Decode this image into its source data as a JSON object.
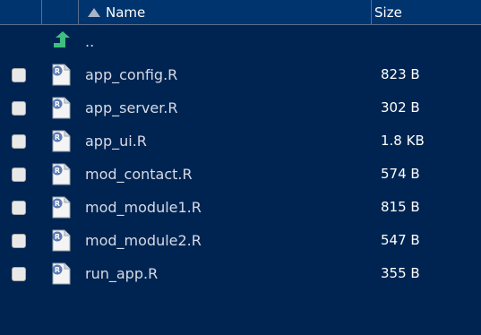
{
  "header": {
    "name_label": "Name",
    "size_label": "Size"
  },
  "parent": {
    "label": ".."
  },
  "files": [
    {
      "name": "app_config.R",
      "size": "823 B"
    },
    {
      "name": "app_server.R",
      "size": "302 B"
    },
    {
      "name": "app_ui.R",
      "size": "1.8 KB"
    },
    {
      "name": "mod_contact.R",
      "size": "574 B"
    },
    {
      "name": "mod_module1.R",
      "size": "815 B"
    },
    {
      "name": "mod_module2.R",
      "size": "547 B"
    },
    {
      "name": "run_app.R",
      "size": "355 B"
    }
  ],
  "colors": {
    "background": "#002451",
    "header": "#00346e",
    "up_arrow": "#3fbf7f"
  },
  "icons": {
    "file": "r-file-icon",
    "parent": "up-arrow-icon",
    "sort": "sort-ascending-icon"
  }
}
